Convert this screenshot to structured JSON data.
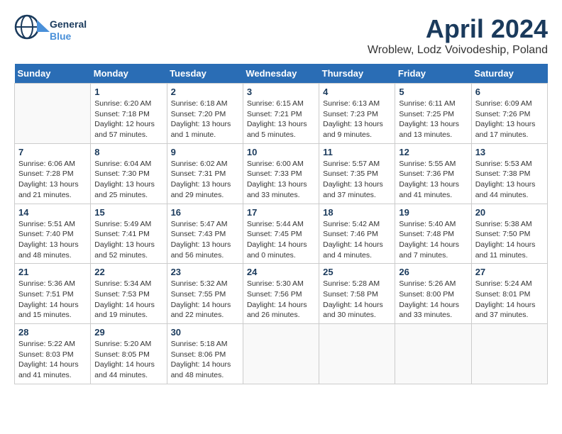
{
  "header": {
    "logo_line1": "General",
    "logo_line2": "Blue",
    "month": "April 2024",
    "location": "Wroblew, Lodz Voivodeship, Poland"
  },
  "days_of_week": [
    "Sunday",
    "Monday",
    "Tuesday",
    "Wednesday",
    "Thursday",
    "Friday",
    "Saturday"
  ],
  "weeks": [
    [
      {
        "day": "",
        "info": ""
      },
      {
        "day": "1",
        "info": "Sunrise: 6:20 AM\nSunset: 7:18 PM\nDaylight: 12 hours\nand 57 minutes."
      },
      {
        "day": "2",
        "info": "Sunrise: 6:18 AM\nSunset: 7:20 PM\nDaylight: 13 hours\nand 1 minute."
      },
      {
        "day": "3",
        "info": "Sunrise: 6:15 AM\nSunset: 7:21 PM\nDaylight: 13 hours\nand 5 minutes."
      },
      {
        "day": "4",
        "info": "Sunrise: 6:13 AM\nSunset: 7:23 PM\nDaylight: 13 hours\nand 9 minutes."
      },
      {
        "day": "5",
        "info": "Sunrise: 6:11 AM\nSunset: 7:25 PM\nDaylight: 13 hours\nand 13 minutes."
      },
      {
        "day": "6",
        "info": "Sunrise: 6:09 AM\nSunset: 7:26 PM\nDaylight: 13 hours\nand 17 minutes."
      }
    ],
    [
      {
        "day": "7",
        "info": "Sunrise: 6:06 AM\nSunset: 7:28 PM\nDaylight: 13 hours\nand 21 minutes."
      },
      {
        "day": "8",
        "info": "Sunrise: 6:04 AM\nSunset: 7:30 PM\nDaylight: 13 hours\nand 25 minutes."
      },
      {
        "day": "9",
        "info": "Sunrise: 6:02 AM\nSunset: 7:31 PM\nDaylight: 13 hours\nand 29 minutes."
      },
      {
        "day": "10",
        "info": "Sunrise: 6:00 AM\nSunset: 7:33 PM\nDaylight: 13 hours\nand 33 minutes."
      },
      {
        "day": "11",
        "info": "Sunrise: 5:57 AM\nSunset: 7:35 PM\nDaylight: 13 hours\nand 37 minutes."
      },
      {
        "day": "12",
        "info": "Sunrise: 5:55 AM\nSunset: 7:36 PM\nDaylight: 13 hours\nand 41 minutes."
      },
      {
        "day": "13",
        "info": "Sunrise: 5:53 AM\nSunset: 7:38 PM\nDaylight: 13 hours\nand 44 minutes."
      }
    ],
    [
      {
        "day": "14",
        "info": "Sunrise: 5:51 AM\nSunset: 7:40 PM\nDaylight: 13 hours\nand 48 minutes."
      },
      {
        "day": "15",
        "info": "Sunrise: 5:49 AM\nSunset: 7:41 PM\nDaylight: 13 hours\nand 52 minutes."
      },
      {
        "day": "16",
        "info": "Sunrise: 5:47 AM\nSunset: 7:43 PM\nDaylight: 13 hours\nand 56 minutes."
      },
      {
        "day": "17",
        "info": "Sunrise: 5:44 AM\nSunset: 7:45 PM\nDaylight: 14 hours\nand 0 minutes."
      },
      {
        "day": "18",
        "info": "Sunrise: 5:42 AM\nSunset: 7:46 PM\nDaylight: 14 hours\nand 4 minutes."
      },
      {
        "day": "19",
        "info": "Sunrise: 5:40 AM\nSunset: 7:48 PM\nDaylight: 14 hours\nand 7 minutes."
      },
      {
        "day": "20",
        "info": "Sunrise: 5:38 AM\nSunset: 7:50 PM\nDaylight: 14 hours\nand 11 minutes."
      }
    ],
    [
      {
        "day": "21",
        "info": "Sunrise: 5:36 AM\nSunset: 7:51 PM\nDaylight: 14 hours\nand 15 minutes."
      },
      {
        "day": "22",
        "info": "Sunrise: 5:34 AM\nSunset: 7:53 PM\nDaylight: 14 hours\nand 19 minutes."
      },
      {
        "day": "23",
        "info": "Sunrise: 5:32 AM\nSunset: 7:55 PM\nDaylight: 14 hours\nand 22 minutes."
      },
      {
        "day": "24",
        "info": "Sunrise: 5:30 AM\nSunset: 7:56 PM\nDaylight: 14 hours\nand 26 minutes."
      },
      {
        "day": "25",
        "info": "Sunrise: 5:28 AM\nSunset: 7:58 PM\nDaylight: 14 hours\nand 30 minutes."
      },
      {
        "day": "26",
        "info": "Sunrise: 5:26 AM\nSunset: 8:00 PM\nDaylight: 14 hours\nand 33 minutes."
      },
      {
        "day": "27",
        "info": "Sunrise: 5:24 AM\nSunset: 8:01 PM\nDaylight: 14 hours\nand 37 minutes."
      }
    ],
    [
      {
        "day": "28",
        "info": "Sunrise: 5:22 AM\nSunset: 8:03 PM\nDaylight: 14 hours\nand 41 minutes."
      },
      {
        "day": "29",
        "info": "Sunrise: 5:20 AM\nSunset: 8:05 PM\nDaylight: 14 hours\nand 44 minutes."
      },
      {
        "day": "30",
        "info": "Sunrise: 5:18 AM\nSunset: 8:06 PM\nDaylight: 14 hours\nand 48 minutes."
      },
      {
        "day": "",
        "info": ""
      },
      {
        "day": "",
        "info": ""
      },
      {
        "day": "",
        "info": ""
      },
      {
        "day": "",
        "info": ""
      }
    ]
  ]
}
